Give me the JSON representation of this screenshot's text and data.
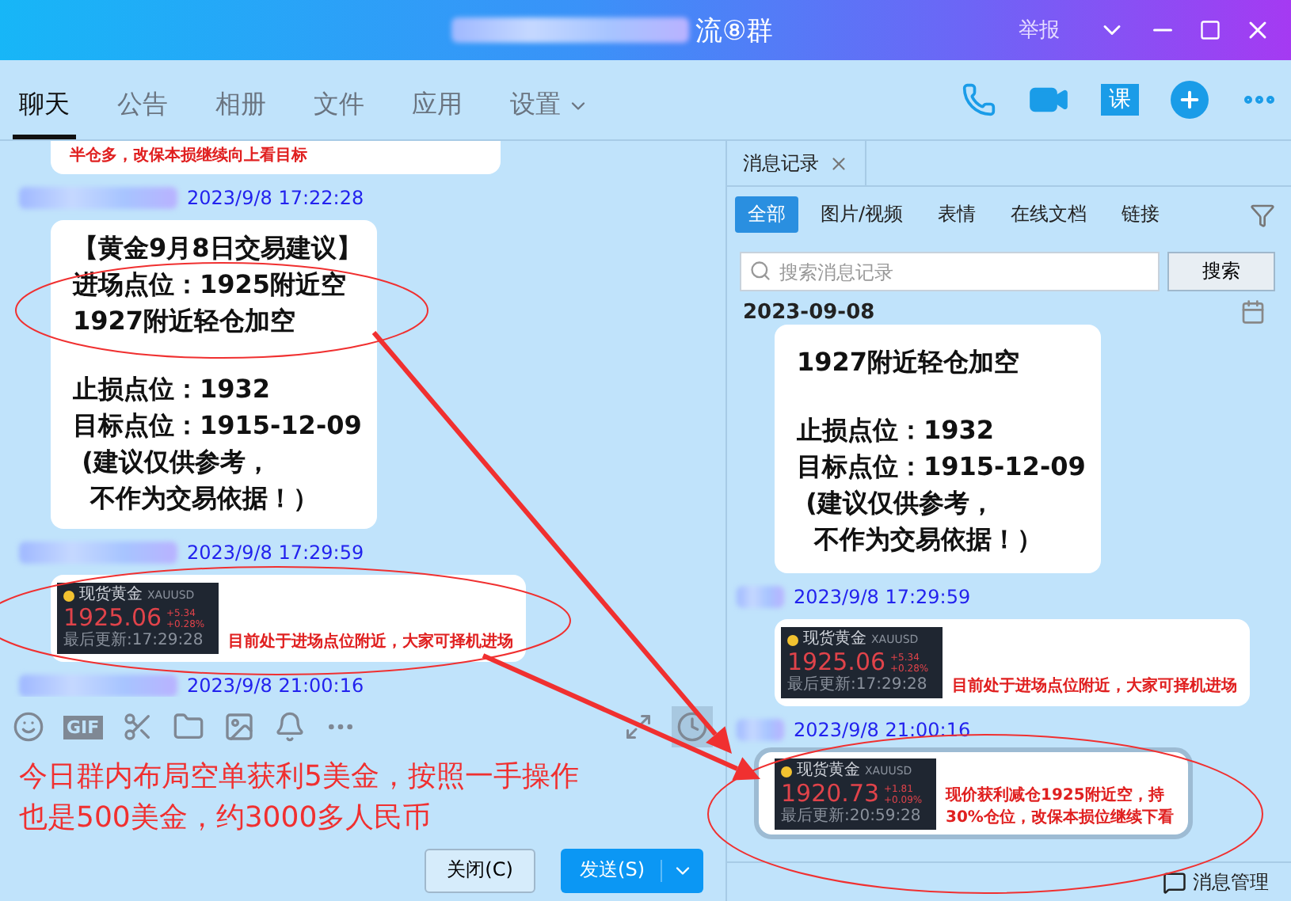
{
  "window": {
    "title": "流⑧群",
    "report": "举报"
  },
  "tabs": [
    {
      "label": "聊天",
      "selected": true,
      "has_menu": false
    },
    {
      "label": "公告",
      "selected": false,
      "has_menu": false
    },
    {
      "label": "相册",
      "selected": false,
      "has_menu": false
    },
    {
      "label": "文件",
      "selected": false,
      "has_menu": false
    },
    {
      "label": "应用",
      "selected": false,
      "has_menu": false
    },
    {
      "label": "设置",
      "selected": false,
      "has_menu": true
    }
  ],
  "actions": [
    {
      "kind": "call"
    },
    {
      "kind": "video"
    },
    {
      "kind": "text",
      "label": "课"
    },
    {
      "kind": "add"
    },
    {
      "kind": "more"
    }
  ],
  "chat": {
    "messages": [
      {
        "kind": "note",
        "text": "半仓多，改保本损继续向上看目标"
      },
      {
        "kind": "text",
        "time": "2023/9/8 17:22:28",
        "paragraphs": [
          [
            "【黄金9月8日交易建议】",
            "进场点位：1925附近空",
            "1927附近轻仓加空"
          ],
          [
            "止损点位：1932",
            "目标点位：1915-12-09",
            " (建议仅供参考，",
            "  不作为交易依据！）"
          ]
        ]
      },
      {
        "kind": "quote",
        "time": "2023/9/8 17:29:59",
        "quote": {
          "name": "现货黄金",
          "symbol": "XAUUSD",
          "price": "1925.06",
          "change": "+5.34",
          "percent": "+0.28%",
          "updated": "最后更新:17:29:28"
        },
        "caption": "目前处于进场点位附近，大家可择机进场"
      },
      {
        "kind": "header",
        "time": "2023/9/8 21:00:16"
      }
    ]
  },
  "toolbar": [
    {
      "kind": "emoji"
    },
    {
      "kind": "text",
      "label": "GIF"
    },
    {
      "kind": "scissors"
    },
    {
      "kind": "folder"
    },
    {
      "kind": "image"
    },
    {
      "kind": "bell"
    },
    {
      "kind": "more"
    }
  ],
  "draft": [
    "今日群内布局空单获利5美金，按照一手操作",
    "也是500美金，约3000多人民币"
  ],
  "buttons": {
    "close": "关闭(C)",
    "send": "发送(S)"
  },
  "history": {
    "tab": "消息记录",
    "filters": [
      {
        "label": "全部",
        "selected": true
      },
      {
        "label": "图片/视频",
        "selected": false
      },
      {
        "label": "表情",
        "selected": false
      },
      {
        "label": "在线文档",
        "selected": false
      },
      {
        "label": "链接",
        "selected": false
      }
    ],
    "search": {
      "placeholder": "搜索消息记录",
      "button": "搜索"
    },
    "date": "2023-09-08",
    "messages": [
      {
        "kind": "text",
        "selected": false,
        "paragraphs": [
          [
            "1927附近轻仓加空"
          ],
          [
            "止损点位：1932",
            "目标点位：1915-12-09",
            " (建议仅供参考，",
            "  不作为交易依据！）"
          ]
        ]
      },
      {
        "kind": "quote",
        "selected": false,
        "time": "2023/9/8 17:29:59",
        "quote": {
          "name": "现货黄金",
          "symbol": "XAUUSD",
          "price": "1925.06",
          "change": "+5.34",
          "percent": "+0.28%",
          "updated": "最后更新:17:29:28"
        },
        "caption": "目前处于进场点位附近，大家可择机进场"
      },
      {
        "kind": "quote",
        "selected": true,
        "time": "2023/9/8 21:00:16",
        "quote": {
          "name": "现货黄金",
          "symbol": "XAUUSD",
          "price": "1920.73",
          "change": "+1.81",
          "percent": "+0.09%",
          "updated": "最后更新:20:59:28"
        },
        "caption": "现价获利减仓1925附近空，持30%仓位，改保本损位继续下看"
      }
    ],
    "footer": "消息管理"
  }
}
